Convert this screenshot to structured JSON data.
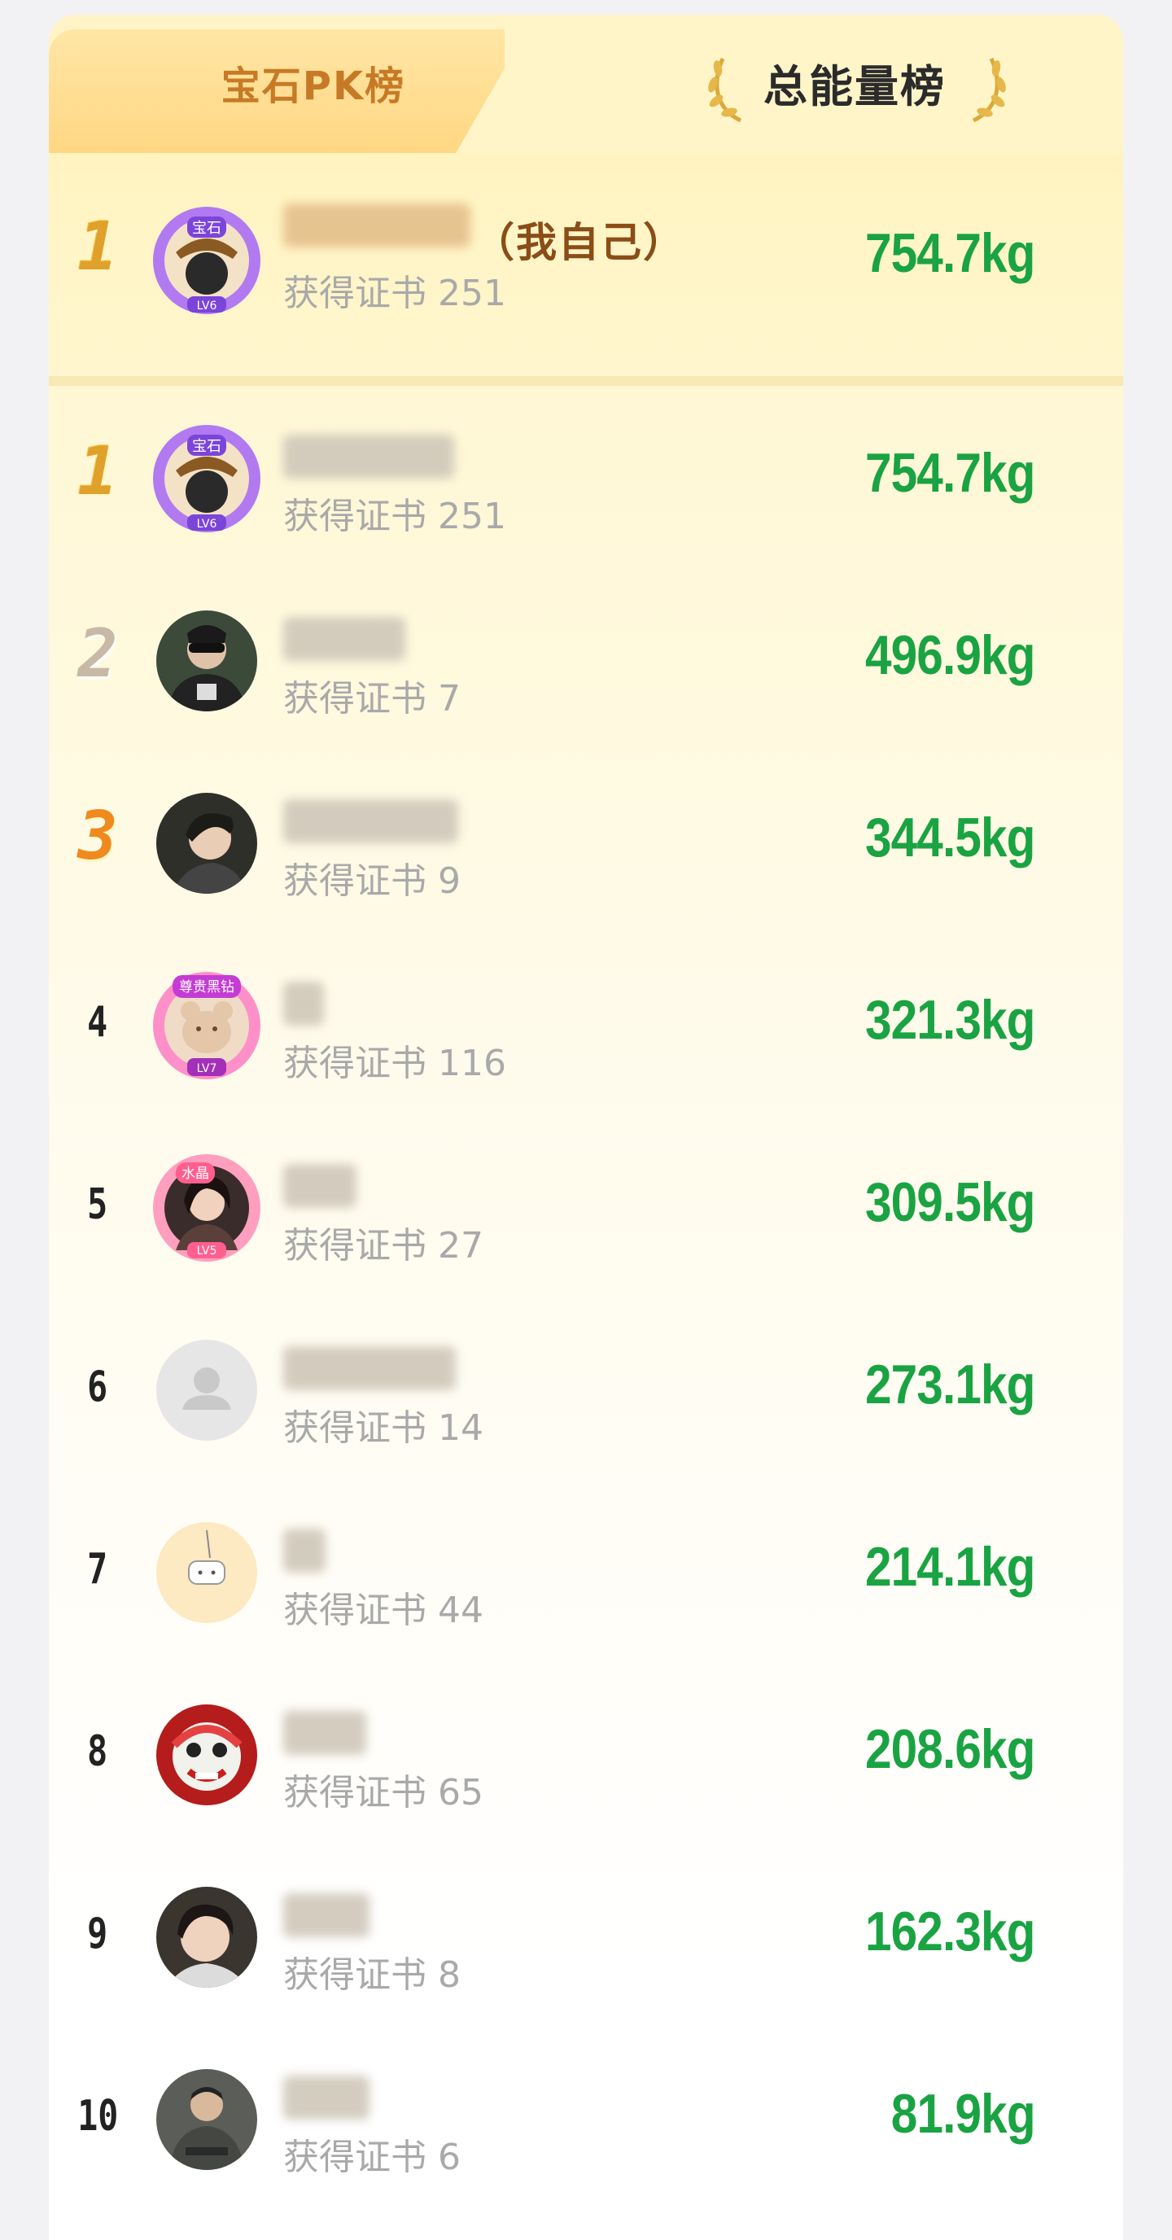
{
  "tabs": {
    "gem_pk": "宝石PK榜",
    "total_energy": "总能量榜"
  },
  "self_entry": {
    "rank": "1",
    "tag": "（我自己）",
    "cert": "获得证书 251",
    "score": "754.7kg",
    "avatar_badge_text": "宝石",
    "avatar_level": "LV6"
  },
  "rankings": [
    {
      "rank": "1",
      "cert": "获得证书 251",
      "score": "754.7kg",
      "avatar": "gem-badge",
      "badge_text": "宝石",
      "level": "LV6"
    },
    {
      "rank": "2",
      "cert": "获得证书 7",
      "score": "496.9kg",
      "avatar": "photo"
    },
    {
      "rank": "3",
      "cert": "获得证书 9",
      "score": "344.5kg",
      "avatar": "photo"
    },
    {
      "rank": "4",
      "cert": "获得证书 116",
      "score": "321.3kg",
      "avatar": "noble-badge",
      "badge_text": "尊贵黑钻",
      "level": "LV7"
    },
    {
      "rank": "5",
      "cert": "获得证书 27",
      "score": "309.5kg",
      "avatar": "crystal-badge",
      "badge_text": "水晶",
      "level": "LV5"
    },
    {
      "rank": "6",
      "cert": "获得证书 14",
      "score": "273.1kg",
      "avatar": "default"
    },
    {
      "rank": "7",
      "cert": "获得证书 44",
      "score": "214.1kg",
      "avatar": "sticker"
    },
    {
      "rank": "8",
      "cert": "获得证书 65",
      "score": "208.6kg",
      "avatar": "lion"
    },
    {
      "rank": "9",
      "cert": "获得证书 8",
      "score": "162.3kg",
      "avatar": "photo"
    },
    {
      "rank": "10",
      "cert": "获得证书 6",
      "score": "81.9kg",
      "avatar": "photo"
    }
  ],
  "colors": {
    "score_green": "#1aa342",
    "self_tag": "#8a4d17",
    "gold_medal": "#e0a12a",
    "silver_medal": "#c8b9a6",
    "bronze_medal": "#ef8a1f",
    "inactive_tab": "#c77a25"
  }
}
